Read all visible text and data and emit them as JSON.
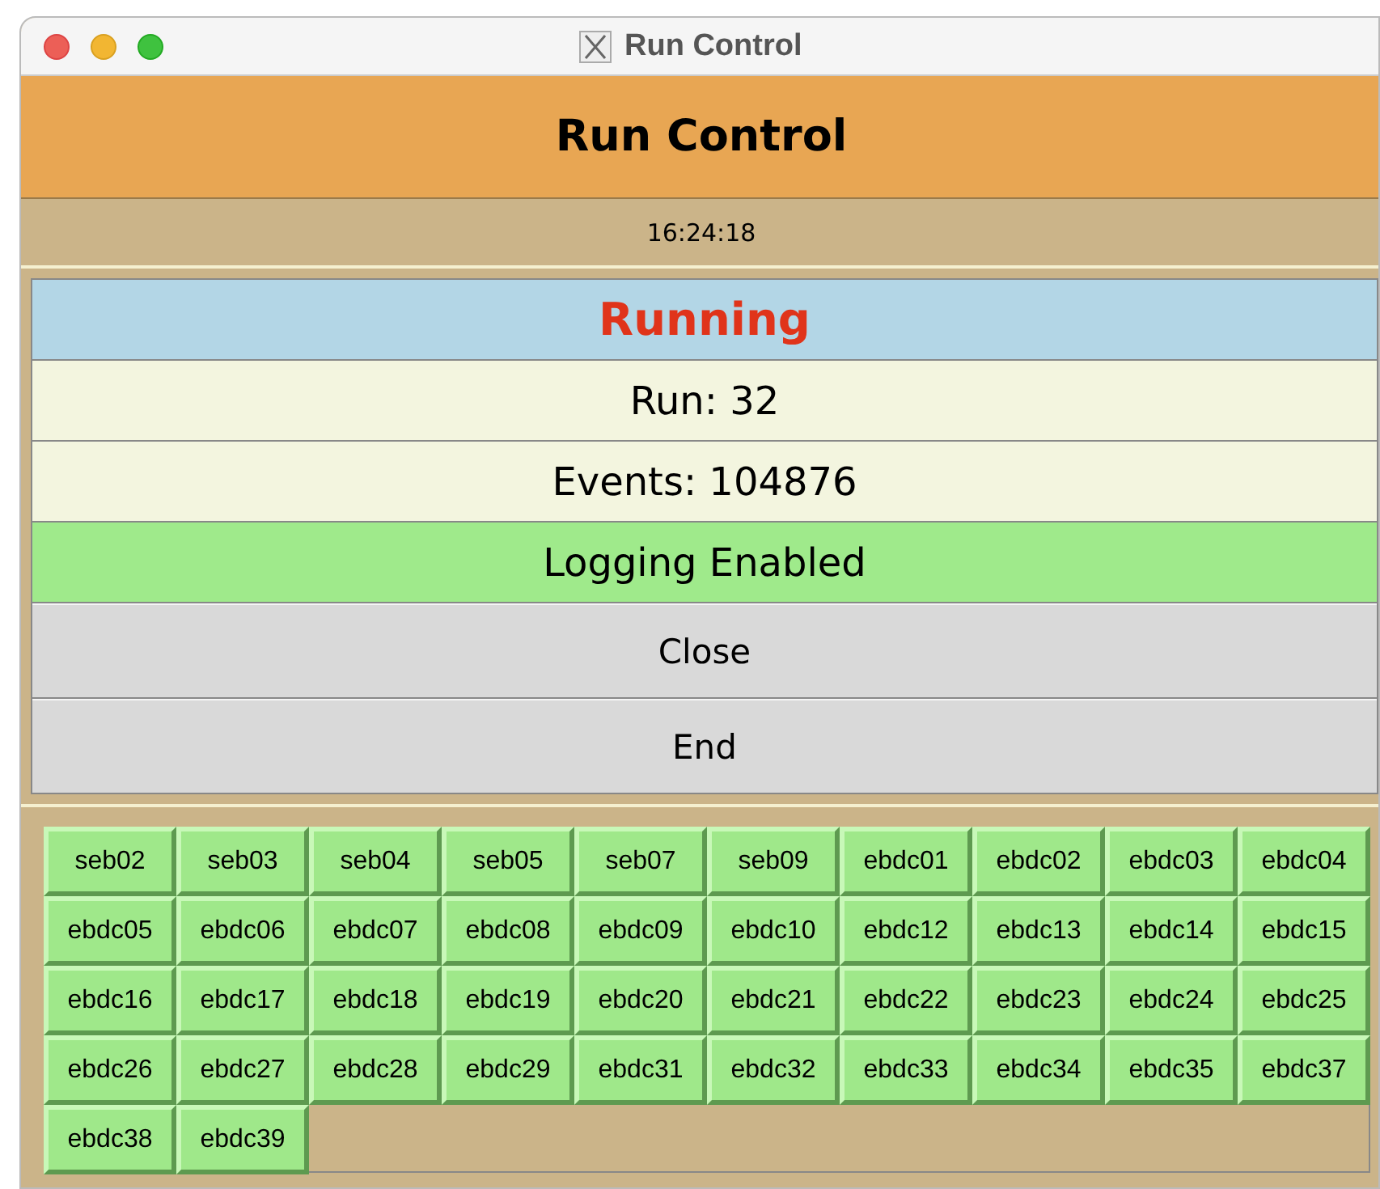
{
  "window": {
    "title": "Run Control"
  },
  "header": {
    "title": "Run Control"
  },
  "clock": "16:24:18",
  "status": {
    "text": "Running"
  },
  "run": "Run: 32",
  "events": "Events: 104876",
  "logging": {
    "text": "Logging Enabled",
    "enabled": true
  },
  "buttons": [
    "Close",
    "End"
  ],
  "nodes": [
    "seb02",
    "seb03",
    "seb04",
    "seb05",
    "seb07",
    "seb09",
    "ebdc01",
    "ebdc02",
    "ebdc03",
    "ebdc04",
    "ebdc05",
    "ebdc06",
    "ebdc07",
    "ebdc08",
    "ebdc09",
    "ebdc10",
    "ebdc12",
    "ebdc13",
    "ebdc14",
    "ebdc15",
    "ebdc16",
    "ebdc17",
    "ebdc18",
    "ebdc19",
    "ebdc20",
    "ebdc21",
    "ebdc22",
    "ebdc23",
    "ebdc24",
    "ebdc25",
    "ebdc26",
    "ebdc27",
    "ebdc28",
    "ebdc29",
    "ebdc31",
    "ebdc32",
    "ebdc33",
    "ebdc34",
    "ebdc35",
    "ebdc37",
    "ebdc38",
    "ebdc39"
  ]
}
